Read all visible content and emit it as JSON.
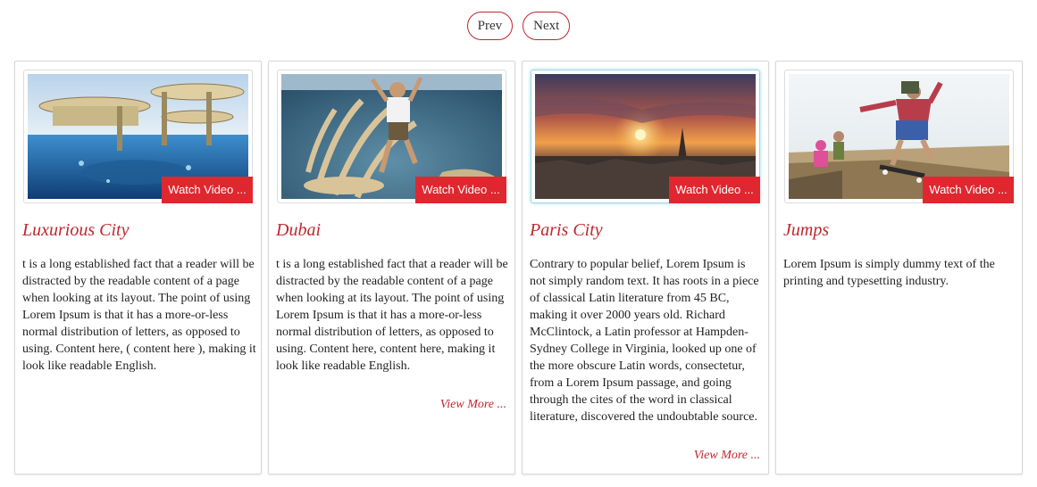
{
  "nav": {
    "prev_label": "Prev",
    "next_label": "Next"
  },
  "colors": {
    "accent": "#c0262e",
    "watch_button": "#e0272f"
  },
  "cards": [
    {
      "title": "Luxurious City",
      "watch_label": "Watch Video ...",
      "text": "t is a long established fact that a reader will be distracted by the readable content of a page when looking at its layout. The point of using Lorem Ipsum is that it has a more-or-less normal distribution of letters, as opposed to using. Content here, ( content here ), making it look like readable English.",
      "view_more": ""
    },
    {
      "title": "Dubai",
      "watch_label": "Watch Video ...",
      "text": "t is a long established fact that a reader will be distracted by the readable content of a page when looking at its layout. The point of using Lorem Ipsum is that it has a more-or-less normal distribution of letters, as opposed to using. Content here, content here, making it look like readable English.",
      "view_more": "View More ..."
    },
    {
      "title": "Paris City",
      "watch_label": "Watch Video ...",
      "text": "Contrary to popular belief, Lorem Ipsum is not simply random text. It has roots in a piece of classical Latin literature from 45 BC, making it over 2000 years old. Richard McClintock, a Latin professor at Hampden-Sydney College in Virginia, looked up one of the more obscure Latin words, consectetur, from a Lorem Ipsum passage, and going through the cites of the word in classical literature, discovered the undoubtable source.",
      "view_more": "View More ..."
    },
    {
      "title": "Jumps",
      "watch_label": "Watch Video ...",
      "text": "Lorem Ipsum is simply dummy text of the printing and typesetting industry.",
      "view_more": ""
    }
  ]
}
